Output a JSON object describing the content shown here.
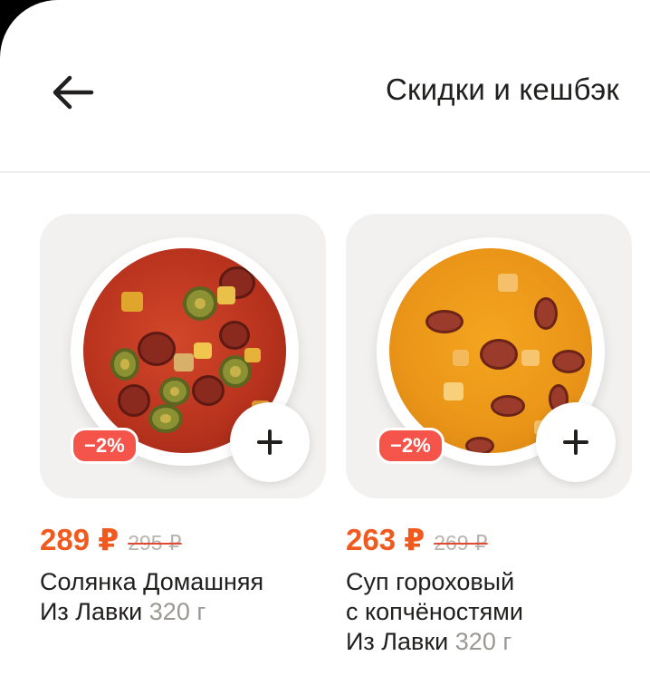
{
  "header": {
    "title": "Скидки и кешбэк"
  },
  "products": [
    {
      "image_alt": "Солянка",
      "discount_badge": "−2%",
      "price": "289 ₽",
      "old_price": "295 ₽",
      "name_line1": "Солянка Домашняя",
      "name_line2": "Из Лавки",
      "weight": "320 г"
    },
    {
      "image_alt": "Гороховый суп",
      "discount_badge": "−2%",
      "price": "263 ₽",
      "old_price": "269 ₽",
      "name_line1": "Суп гороховый",
      "name_line2": "с копчёностями",
      "name_line3": "Из Лавки",
      "weight": "320 г"
    }
  ],
  "colors": {
    "price": "#f05a1e",
    "badge": "#f5544a",
    "tile_bg": "#f2f1ef"
  }
}
